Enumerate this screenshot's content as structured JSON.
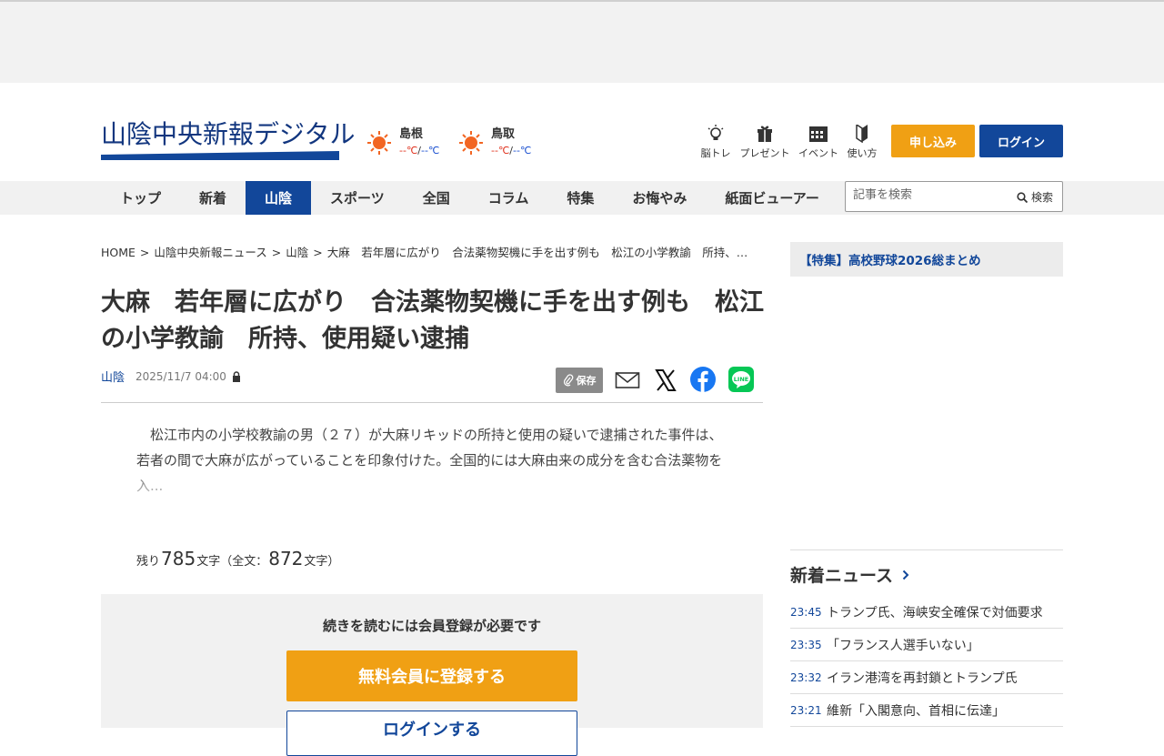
{
  "header": {
    "logo_text": "山陰中央新報デジタル",
    "weather": [
      {
        "name": "島根",
        "hi": "--℃",
        "sep": "/",
        "lo": "--℃"
      },
      {
        "name": "鳥取",
        "hi": "--℃",
        "sep": "/",
        "lo": "--℃"
      }
    ],
    "icons": [
      {
        "label": "脳トレ",
        "icon": "lightbulb-icon"
      },
      {
        "label": "プレゼント",
        "icon": "gift-icon"
      },
      {
        "label": "イベント",
        "icon": "calendar-icon"
      },
      {
        "label": "使い方",
        "icon": "beginner-mark-icon"
      }
    ],
    "apply_label": "申し込み",
    "login_label": "ログイン"
  },
  "nav": {
    "items": [
      "トップ",
      "新着",
      "山陰",
      "スポーツ",
      "全国",
      "コラム",
      "特集",
      "お悔やみ",
      "紙面ビューアー"
    ],
    "active": "山陰",
    "search_placeholder": "記事を検索",
    "search_button": "検索"
  },
  "breadcrumb": [
    "HOME",
    "山陰中央新報ニュース",
    "山陰",
    "大麻　若年層に広がり　合法薬物契機に手を出す例も　松江の小学教諭　所持、…"
  ],
  "article": {
    "title": "大麻　若年層に広がり　合法薬物契機に手を出す例も　松江の小学教諭　所持、使用疑い逮捕",
    "category": "山陰",
    "date": "2025/11/7 04:00",
    "save_label": "保存",
    "body": "　松江市内の小学校教諭の男（２７）が大麻リキッドの所持と使用の疑いで逮捕された事件は、若者の間で大麻が広がっていることを印象付けた。全国的には大麻由来の成分を含む合法薬物を入...",
    "remain_prefix": "残り",
    "remain_chars": "785",
    "remain_mid": "文字（全文：",
    "total_chars": "872",
    "remain_suffix": "文字）"
  },
  "paywall": {
    "message": "続きを読むには会員登録が必要です",
    "register_label": "無料会員に登録する",
    "login_label": "ログインする"
  },
  "sidebar": {
    "feature_label": "【特集】高校野球2026総まとめ",
    "news_title": "新着ニュース",
    "news": [
      {
        "time": "23:45",
        "title": "トランプ氏、海峡安全確保で対価要求"
      },
      {
        "time": "23:35",
        "title": "「フランス人選手いない」"
      },
      {
        "time": "23:32",
        "title": "イラン港湾を再封鎖とトランプ氏"
      },
      {
        "time": "23:21",
        "title": "維新「入閣意向、首相に伝達」"
      }
    ]
  },
  "colors": {
    "brand_blue": "#12479a",
    "accent_orange": "#f0a014",
    "sun": "#f26522"
  }
}
